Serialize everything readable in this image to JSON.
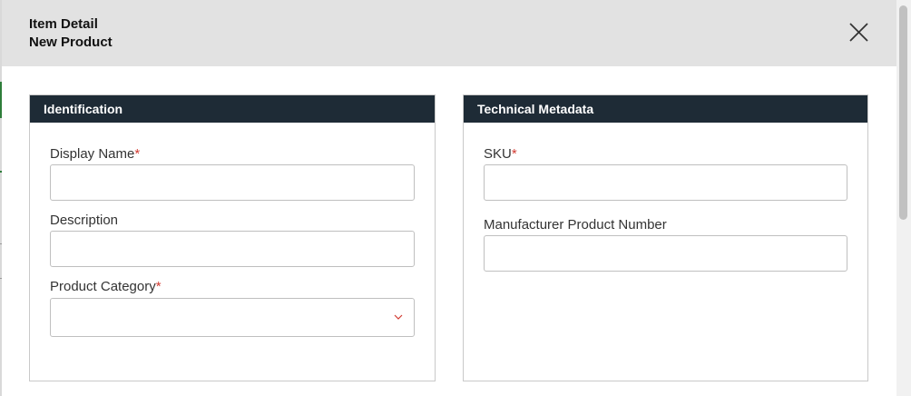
{
  "modal": {
    "title": "Item Detail",
    "subtitle": "New Product",
    "close_icon": "close-icon"
  },
  "identification": {
    "heading": "Identification",
    "display_name": {
      "label": "Display Name",
      "required_mark": "*",
      "value": ""
    },
    "description": {
      "label": "Description",
      "value": ""
    },
    "product_category": {
      "label": "Product Category",
      "required_mark": "*",
      "selected": "",
      "icon": "chevron-down-icon"
    }
  },
  "technical_metadata": {
    "heading": "Technical Metadata",
    "sku": {
      "label": "SKU",
      "required_mark": "*",
      "value": ""
    },
    "manufacturer_product_number": {
      "label": "Manufacturer Product Number",
      "value": ""
    }
  },
  "colors": {
    "panel_header": "#1e2b36",
    "modal_header": "#e2e2e2",
    "required": "#d23b32"
  }
}
